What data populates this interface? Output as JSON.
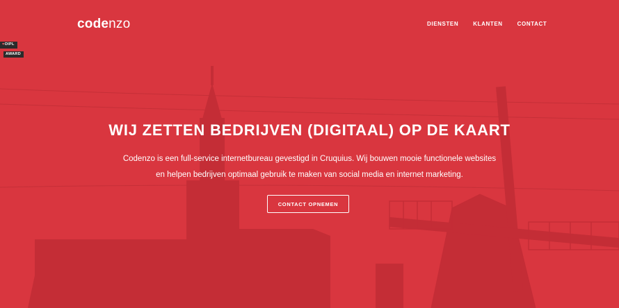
{
  "header": {
    "logo_bold": "code",
    "logo_light": "nzo",
    "nav": [
      "DIENSTEN",
      "KLANTEN",
      "CONTACT"
    ]
  },
  "award_badge": {
    "line1": "OIPL",
    "line2": "AWARD"
  },
  "hero": {
    "headline": "WIJ ZETTEN BEDRIJVEN (DIGITAAL) OP DE KAART",
    "intro": "Codenzo is een full-service internetbureau gevestigd in Cruquius. Wij bouwen mooie functionele websites en helpen bedrijven optimaal gebruik te maken van social media en internet marketing.",
    "cta": "CONTACT OPNEMEN"
  },
  "colors": {
    "accent_red": "#d9363f",
    "silhouette": "#c42a34",
    "text": "#ffffff"
  }
}
